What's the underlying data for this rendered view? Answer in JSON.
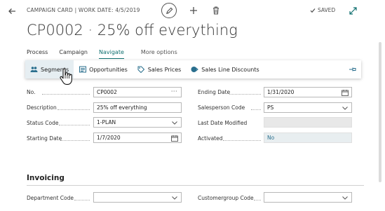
{
  "header": {
    "breadcrumb": "CAMPAIGN CARD | WORK DATE: 4/5/2019",
    "saved_label": "SAVED",
    "title": "CP0002 · 25% off everything"
  },
  "menu": {
    "items": [
      {
        "label": "Process"
      },
      {
        "label": "Campaign"
      },
      {
        "label": "Navigate"
      },
      {
        "label": "More options"
      }
    ],
    "active": "Navigate"
  },
  "actions": [
    {
      "label": "Segments",
      "icon": "people-icon"
    },
    {
      "label": "Opportunities",
      "icon": "opportunities-icon"
    },
    {
      "label": "Sales Prices",
      "icon": "price-tag-icon"
    },
    {
      "label": "Sales Line Discounts",
      "icon": "discount-icon"
    }
  ],
  "general": {
    "no_label": "No.",
    "no_value": "CP0002",
    "description_label": "Description",
    "description_value": "25% off everything",
    "status_label": "Status Code",
    "status_value": "1-PLAN",
    "starting_label": "Starting Date",
    "starting_value": "1/7/2020",
    "ending_label": "Ending Date",
    "ending_value": "1/31/2020",
    "salesperson_label": "Salesperson Code",
    "salesperson_value": "PS",
    "last_modified_label": "Last Date Modified",
    "last_modified_value": "",
    "activated_label": "Activated",
    "activated_value": "No"
  },
  "invoicing": {
    "title": "Invoicing",
    "department_label": "Department Code",
    "department_value": "",
    "customergroup_label": "Customergroup Code",
    "customergroup_value": ""
  },
  "colors": {
    "accent": "#0f6f6f",
    "icon_blue": "#2a6f8e"
  }
}
